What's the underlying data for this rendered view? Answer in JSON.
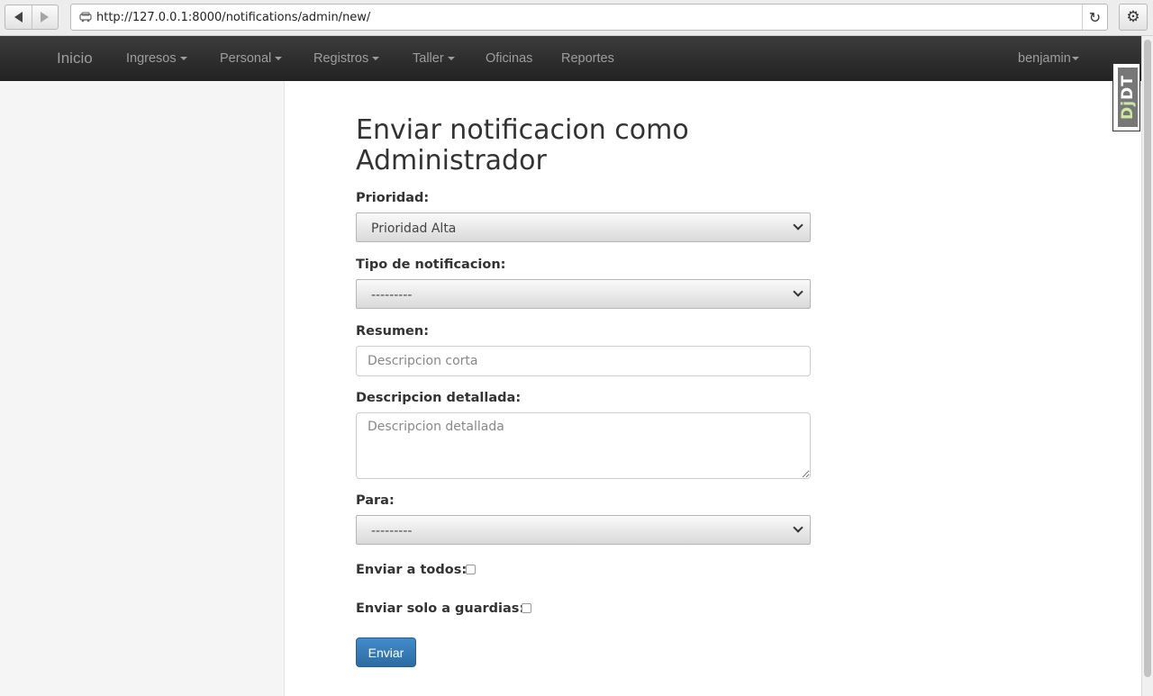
{
  "browser": {
    "url": "http://127.0.0.1:8000/notifications/admin/new/",
    "reload_icon": "↻",
    "settings_icon": "⚙"
  },
  "navbar": {
    "brand": "Inicio",
    "items": [
      {
        "label": "Ingresos",
        "dropdown": true
      },
      {
        "label": "Personal",
        "dropdown": true
      },
      {
        "label": "Registros",
        "dropdown": true
      },
      {
        "label": "Taller",
        "dropdown": true
      },
      {
        "label": "Oficinas",
        "dropdown": false
      },
      {
        "label": "Reportes",
        "dropdown": false
      }
    ],
    "user": "benjamin"
  },
  "debug_toolbar": {
    "label_dj": "Dj",
    "label_dt": "DT"
  },
  "form": {
    "title": "Enviar notificacion como Administrador",
    "prioridad": {
      "label": "Prioridad:",
      "value": "Prioridad Alta"
    },
    "tipo": {
      "label": "Tipo de notificacion:",
      "value": "---------"
    },
    "resumen": {
      "label": "Resumen:",
      "placeholder": "Descripcion corta"
    },
    "descripcion": {
      "label": "Descripcion detallada:",
      "placeholder": "Descripcion detallada"
    },
    "para": {
      "label": "Para:",
      "value": "---------"
    },
    "enviar_todos": {
      "label": "Enviar a todos:",
      "checked": false
    },
    "enviar_guardias": {
      "label": "Enviar solo a guardias:",
      "checked": false
    },
    "submit_label": "Enviar"
  },
  "colors": {
    "navbar_bg": "#222222",
    "primary_button": "#428bca",
    "sidebar_bg": "#f5f5f5"
  }
}
